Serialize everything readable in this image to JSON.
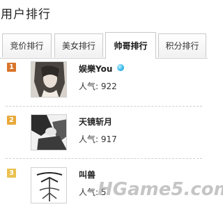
{
  "header": {
    "title": "用户排行"
  },
  "tabs": [
    {
      "label": "竞价排行",
      "active": false
    },
    {
      "label": "美女排行",
      "active": false
    },
    {
      "label": "帅哥排行",
      "active": true
    },
    {
      "label": "积分排行",
      "active": false
    }
  ],
  "rankings": [
    {
      "rank": "1",
      "name": "娱樂You",
      "popularity": "人气: 922",
      "badge_color": "#d9752b",
      "vip": true
    },
    {
      "rank": "2",
      "name": "天镜斩月",
      "popularity": "人气: 917",
      "badge_color": "#e8a93a",
      "vip": false
    },
    {
      "rank": "3",
      "name": "叫兽",
      "popularity": "人气: 5",
      "badge_color": "#eac14f",
      "vip": false
    }
  ],
  "watermark": {
    "text": "HGame5.com"
  },
  "colors": {
    "border": "#c9c9c9",
    "vip_icon": "#33b6e8"
  }
}
